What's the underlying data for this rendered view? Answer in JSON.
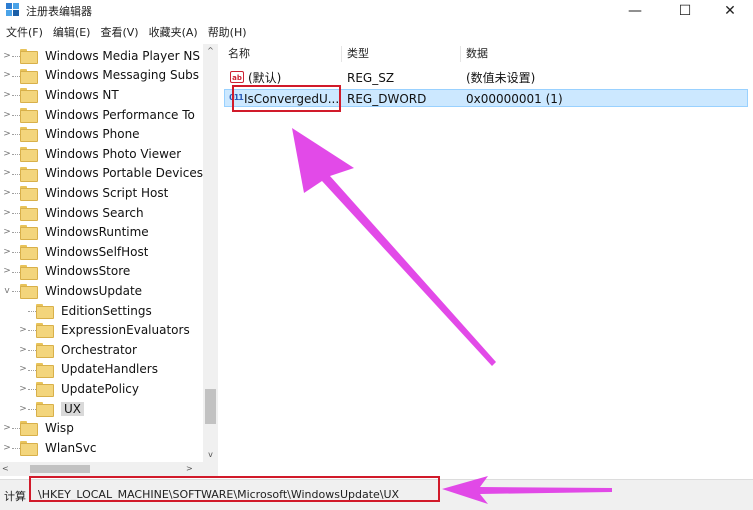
{
  "window": {
    "title": "注册表编辑器",
    "minimize_glyph": "—",
    "maximize_glyph": "☐",
    "close_glyph": "✕"
  },
  "menu": [
    "文件(F)",
    "编辑(E)",
    "查看(V)",
    "收藏夹(A)",
    "帮助(H)"
  ],
  "tree": {
    "items": [
      {
        "label": "Windows Media Player NS",
        "expander": ">"
      },
      {
        "label": "Windows Messaging Subs",
        "expander": ">"
      },
      {
        "label": "Windows NT",
        "expander": ">"
      },
      {
        "label": "Windows Performance To",
        "expander": ">"
      },
      {
        "label": "Windows Phone",
        "expander": ">"
      },
      {
        "label": "Windows Photo Viewer",
        "expander": ">"
      },
      {
        "label": "Windows Portable Devices",
        "expander": ">"
      },
      {
        "label": "Windows Script Host",
        "expander": ">"
      },
      {
        "label": "Windows Search",
        "expander": ">"
      },
      {
        "label": "WindowsRuntime",
        "expander": ">"
      },
      {
        "label": "WindowsSelfHost",
        "expander": ">"
      },
      {
        "label": "WindowsStore",
        "expander": ">"
      },
      {
        "label": "WindowsUpdate",
        "expander": "v"
      },
      {
        "label": "EditionSettings",
        "expander": ""
      },
      {
        "label": "ExpressionEvaluators",
        "expander": ">"
      },
      {
        "label": "Orchestrator",
        "expander": ">"
      },
      {
        "label": "UpdateHandlers",
        "expander": ">"
      },
      {
        "label": "UpdatePolicy",
        "expander": ">"
      },
      {
        "label": "UX",
        "expander": ">"
      },
      {
        "label": "Wisp",
        "expander": ">"
      },
      {
        "label": "WlanSvc",
        "expander": ">"
      }
    ],
    "scroll_up": "^",
    "scroll_down": "v",
    "scroll_left": "<",
    "scroll_right": ">"
  },
  "list": {
    "columns": [
      "名称",
      "类型",
      "数据"
    ],
    "rows": [
      {
        "icon": "string-value-icon",
        "icon_text": "ab",
        "name": "(默认)",
        "type": "REG_SZ",
        "data": "(数值未设置)"
      },
      {
        "icon": "dword-value-icon",
        "icon_text": "011",
        "name": "IsConvergedU...",
        "type": "REG_DWORD",
        "data": "0x00000001 (1)"
      }
    ]
  },
  "status": {
    "prefix": "计算",
    "path": "\\HKEY_LOCAL_MACHINE\\SOFTWARE\\Microsoft\\WindowsUpdate\\UX"
  },
  "colors": {
    "annotation": "#d11a2a",
    "arrow": "#e03be6",
    "selection": "#cce8ff"
  }
}
